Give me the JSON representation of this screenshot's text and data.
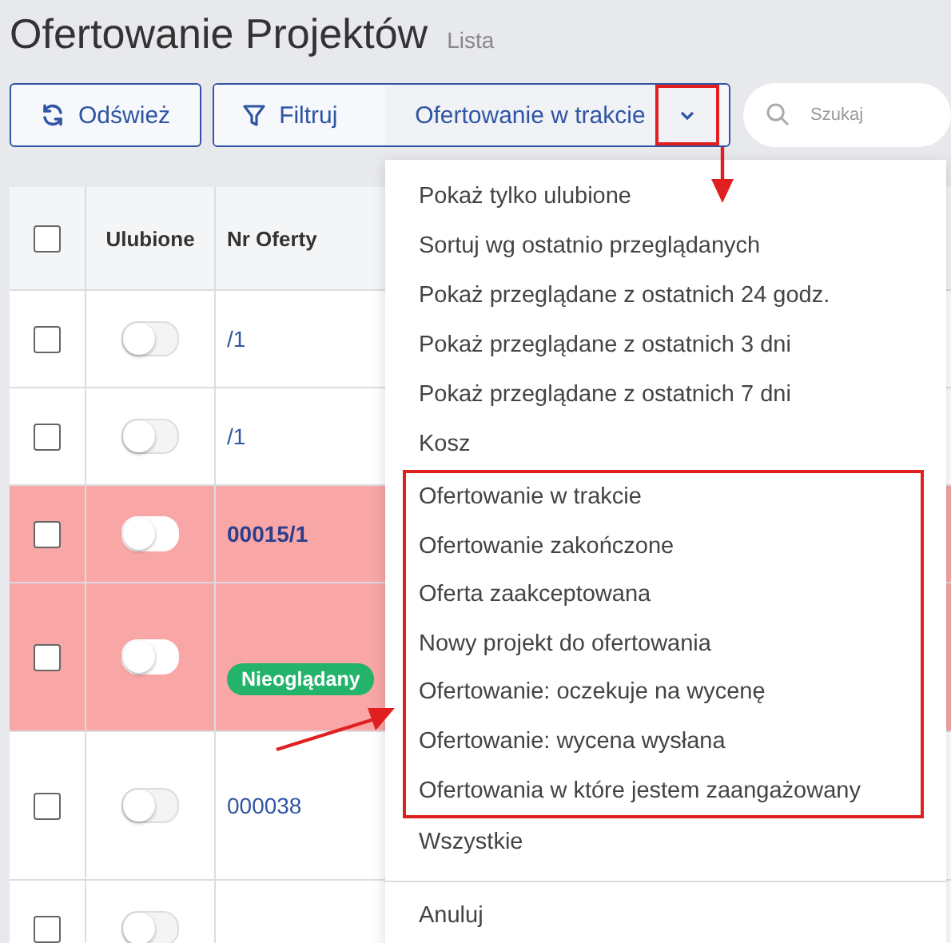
{
  "header": {
    "title": "Ofertowanie Projektów",
    "subtitle": "Lista"
  },
  "toolbar": {
    "refresh": "Odśwież",
    "filter": "Filtruj",
    "current_filter": "Ofertowanie w trakcie",
    "search": {
      "placeholder": "Szukaj"
    }
  },
  "table": {
    "select_all": {
      "checked": false
    },
    "columns": [
      "Ulubione",
      "Nr Oferty"
    ],
    "rows": [
      {
        "checked": false,
        "favorite": false,
        "highlighted": false,
        "number": "/1",
        "bold": false,
        "tall": false
      },
      {
        "checked": false,
        "favorite": false,
        "highlighted": false,
        "number": "/1",
        "bold": false,
        "tall": false
      },
      {
        "checked": false,
        "favorite": false,
        "highlighted": true,
        "number": "00015/1",
        "bold": true,
        "tall": false
      },
      {
        "checked": false,
        "favorite": false,
        "highlighted": true,
        "badge": "Nieoglądany",
        "tall": true
      },
      {
        "checked": false,
        "favorite": false,
        "highlighted": false,
        "number": "000038",
        "bold": false,
        "tall": true
      },
      {
        "checked": false,
        "favorite": false,
        "highlighted": false,
        "tall": false
      }
    ]
  },
  "menu": {
    "items": [
      {
        "label": "Pokaż tylko ulubione",
        "annotated": false
      },
      {
        "label": "Sortuj wg ostatnio przeglądanych",
        "annotated": false
      },
      {
        "label": "Pokaż przeglądane z ostatnich 24 godz.",
        "annotated": false
      },
      {
        "label": "Pokaż przeglądane z ostatnich 3 dni",
        "annotated": false
      },
      {
        "label": "Pokaż przeglądane z ostatnich 7 dni",
        "annotated": false
      },
      {
        "label": "Kosz",
        "annotated": false
      },
      {
        "label": "Ofertowanie w trakcie",
        "annotated": true
      },
      {
        "label": "Ofertowanie zakończone",
        "annotated": true
      },
      {
        "label": "Oferta zaakceptowana",
        "annotated": true
      },
      {
        "label": "Nowy projekt do ofertowania",
        "annotated": true
      },
      {
        "label": "Ofertowanie: oczekuje na wycenę",
        "annotated": true
      },
      {
        "label": "Ofertowanie: wycena wysłana",
        "annotated": true
      },
      {
        "label": "Ofertowania w które jestem zaangażowany",
        "annotated": true
      },
      {
        "label": "Wszystkie",
        "annotated": false
      }
    ],
    "cancel": "Anuluj"
  }
}
